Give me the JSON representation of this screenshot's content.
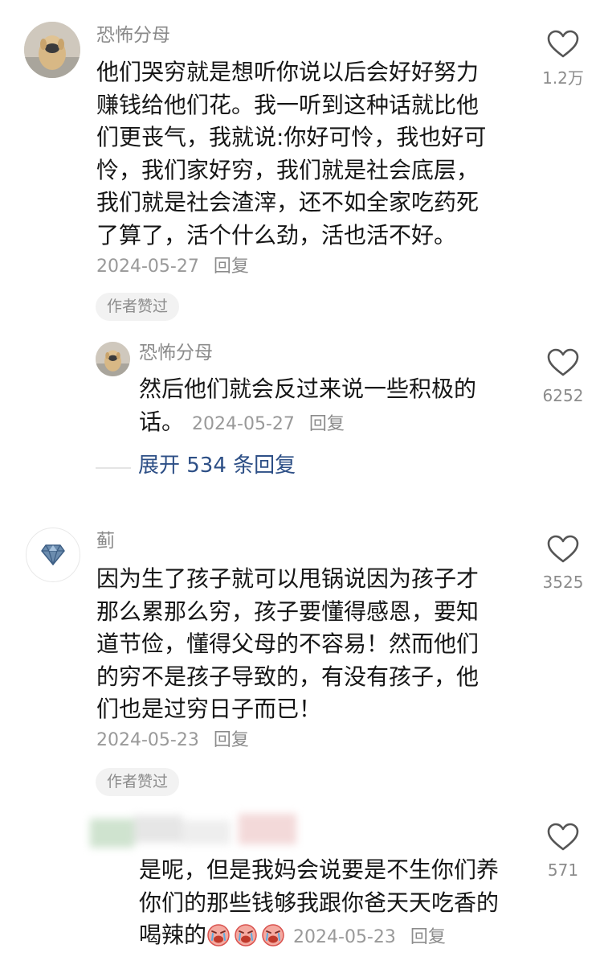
{
  "comments": [
    {
      "username": "恐怖分母",
      "lines": [
        "他们哭穷就是想听你说以后会好好努力",
        "赚钱给他们花。我一听到这种话就比他",
        "们更丧气，我就说:你好可怜，我也好可",
        "怜，我们家好穷，我们就是社会底层，",
        "我们就是社会渣滓，还不如全家吃药死",
        "了算了，活个什么劲，活也活不好。"
      ],
      "date": "2024-05-27",
      "reply_label": "回复",
      "badge": "作者赞过",
      "likes": "1.2万",
      "reply": {
        "username": "恐怖分母",
        "line1": "然后他们就会反过来说一些积极的",
        "line2": "话。",
        "date": "2024-05-27",
        "reply_label": "回复",
        "likes": "6252"
      },
      "expand_label": "展开 534 条回复"
    },
    {
      "username": "蓟",
      "lines": [
        "因为生了孩子就可以甩锅说因为孩子才",
        "那么累那么穷，孩子要懂得感恩，要知",
        "道节俭，懂得父母的不容易！然而他们",
        "的穷不是孩子导致的，有没有孩子，他",
        "们也是过穷日子而已！"
      ],
      "date": "2024-05-23",
      "reply_label": "回复",
      "badge": "作者赞过",
      "likes": "3525",
      "reply": {
        "line1": "是呢，但是我妈会说要是不生你们养",
        "line2": "你们的那些钱够我跟你爸天天吃香的",
        "line3": "喝辣的",
        "emojis": [
          "crying-face-emoji",
          "crying-face-emoji",
          "crying-face-emoji"
        ],
        "date": "2024-05-23",
        "reply_label": "回复",
        "likes": "571"
      }
    }
  ],
  "icons": {
    "like": "heart-outline-icon",
    "avatar2": "diamond-icon"
  },
  "colors": {
    "expand_link": "#2d4f86",
    "meta_text": "#999999",
    "badge_bg": "#f2f2f2"
  }
}
